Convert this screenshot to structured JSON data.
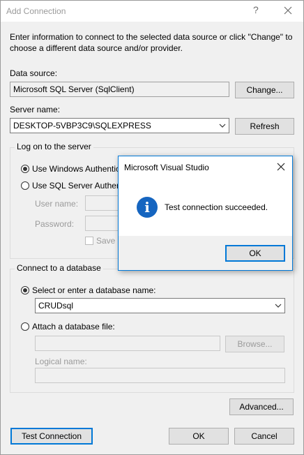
{
  "window": {
    "title": "Add Connection",
    "help_glyph": "?",
    "intro_text": "Enter information to connect to the selected data source or click \"Change\" to choose a different data source and/or provider."
  },
  "data_source": {
    "label": "Data source:",
    "value": "Microsoft SQL Server (SqlClient)",
    "change_label": "Change..."
  },
  "server": {
    "label": "Server name:",
    "value": "DESKTOP-5VBP3C9\\SQLEXPRESS",
    "refresh_label": "Refresh"
  },
  "logon": {
    "title": "Log on to the server",
    "windows_auth": "Use Windows Authentication",
    "sql_auth": "Use SQL Server Authentication",
    "username_label": "User name:",
    "password_label": "Password:",
    "save_password": "Save my password",
    "selected": "windows_auth"
  },
  "database": {
    "title": "Connect to a database",
    "select_label": "Select or enter a database name:",
    "db_name": "CRUDsql",
    "attach_label": "Attach a database file:",
    "browse_label": "Browse...",
    "logical_label": "Logical name:",
    "selected": "select"
  },
  "footer": {
    "advanced_label": "Advanced...",
    "test_label": "Test Connection",
    "ok_label": "OK",
    "cancel_label": "Cancel"
  },
  "message_box": {
    "title": "Microsoft Visual Studio",
    "message": "Test connection succeeded.",
    "ok_label": "OK",
    "icon": "info-icon"
  },
  "colors": {
    "accent": "#0078d7",
    "info_icon": "#1565c0",
    "window_bg": "#f0f0f0"
  }
}
